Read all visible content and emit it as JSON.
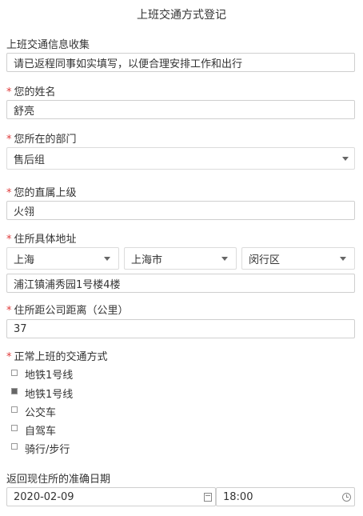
{
  "page": {
    "title": "上班交通方式登记"
  },
  "sections": {
    "info": {
      "label": "上班交通信息收集",
      "value": "请已返程同事如实填写，以便合理安排工作和出行"
    },
    "name": {
      "label": "您的姓名",
      "value": "舒亮",
      "required": true
    },
    "dept": {
      "label": "您所在的部门",
      "value": "售后组",
      "required": true
    },
    "manager": {
      "label": "您的直属上级",
      "value": "火翎",
      "required": true
    },
    "address": {
      "label": "住所具体地址",
      "required": true,
      "province": "上海",
      "city": "上海市",
      "district": "闵行区",
      "detail": "浦江镇浦秀园1号楼4楼"
    },
    "distance": {
      "label": "住所距公司距离（公里）",
      "value": "37",
      "required": true
    },
    "transport": {
      "label": "正常上班的交通方式",
      "required": true,
      "options": [
        {
          "label": "地铁1号线",
          "checked": false
        },
        {
          "label": "地铁1号线",
          "checked": true
        },
        {
          "label": "公交车",
          "checked": false
        },
        {
          "label": "自驾车",
          "checked": false
        },
        {
          "label": "骑行/步行",
          "checked": false
        }
      ]
    },
    "return_date": {
      "label": "返回现住所的准确日期",
      "date": "2020-02-09",
      "time": "18:00"
    }
  },
  "icons": {
    "select": "chevron-down-icon",
    "date": "calendar-icon",
    "time": "clock-icon"
  },
  "colors": {
    "required": "#e03a3a",
    "border": "#cfcfcf"
  }
}
